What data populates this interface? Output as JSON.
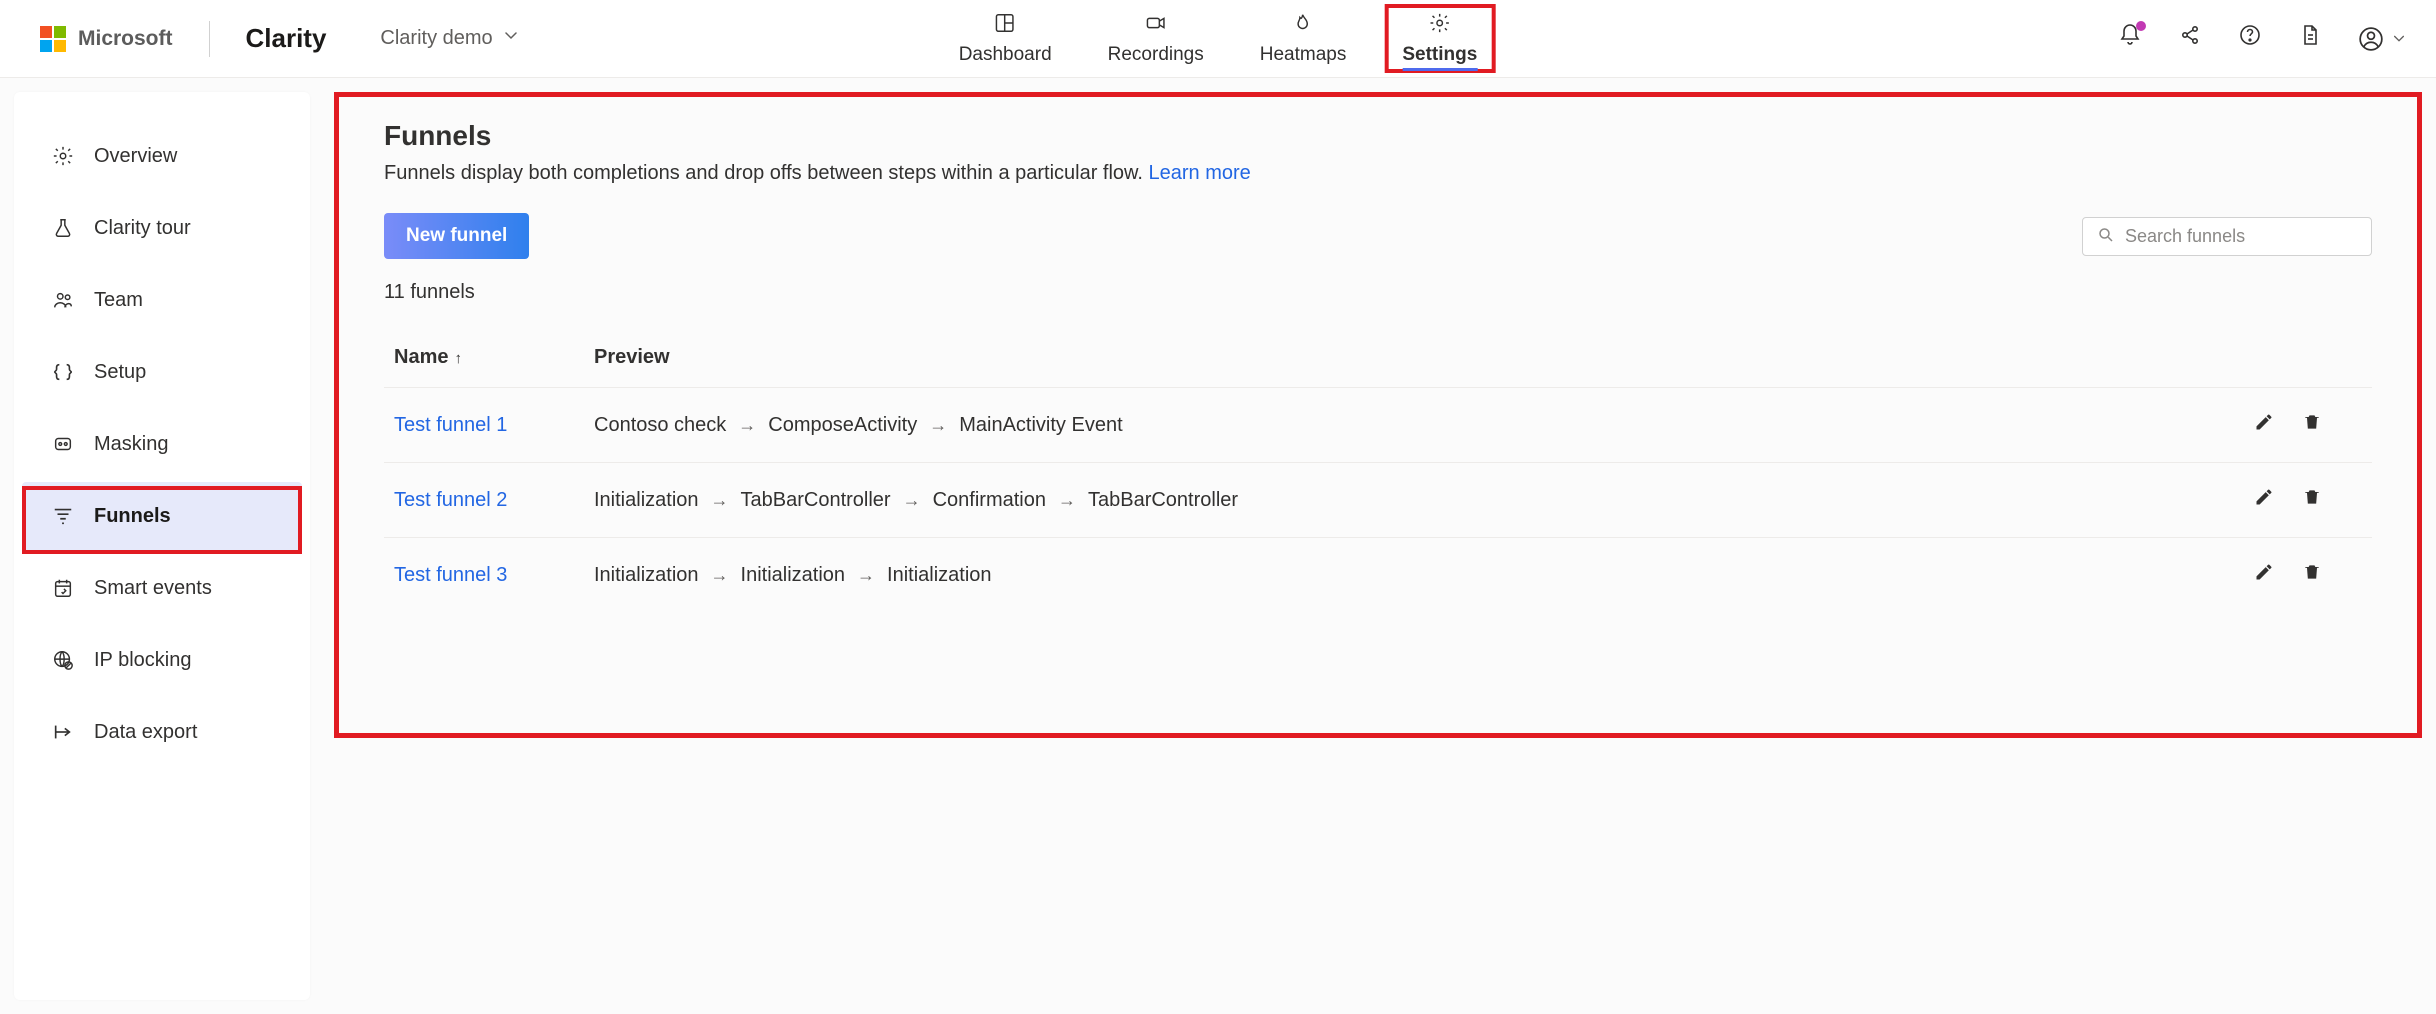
{
  "brand": {
    "microsoft": "Microsoft",
    "product": "Clarity"
  },
  "project": {
    "name": "Clarity demo"
  },
  "nav": {
    "dashboard": "Dashboard",
    "recordings": "Recordings",
    "heatmaps": "Heatmaps",
    "settings": "Settings"
  },
  "sidebar": {
    "overview": "Overview",
    "clarity_tour": "Clarity tour",
    "team": "Team",
    "setup": "Setup",
    "masking": "Masking",
    "funnels": "Funnels",
    "smart_events": "Smart events",
    "ip_blocking": "IP blocking",
    "data_export": "Data export"
  },
  "page": {
    "title": "Funnels",
    "subtitle_text": "Funnels display both completions and drop offs between steps within a particular flow. ",
    "learn_more": "Learn more",
    "new_button": "New funnel",
    "search_placeholder": "Search funnels",
    "count_text": "11 funnels"
  },
  "table": {
    "col_name": "Name",
    "col_preview": "Preview",
    "rows": [
      {
        "name": "Test funnel 1",
        "steps": [
          "Contoso check",
          "ComposeActivity",
          "MainActivity Event"
        ]
      },
      {
        "name": "Test funnel 2",
        "steps": [
          "Initialization",
          "TabBarController",
          "Confirmation",
          "TabBarController"
        ]
      },
      {
        "name": "Test funnel 3",
        "steps": [
          "Initialization",
          "Initialization",
          "Initialization"
        ]
      }
    ]
  }
}
